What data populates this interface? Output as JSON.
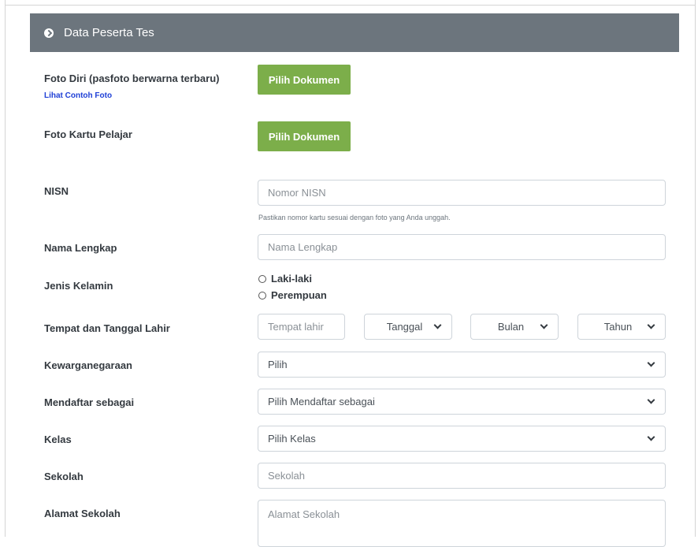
{
  "panel": {
    "title": "Data Peserta Tes",
    "icon": "chevron-circle-right-icon"
  },
  "colors": {
    "header_bg": "#6c757d",
    "button_bg": "#7cae4a",
    "link": "#1e3fd6"
  },
  "foto_diri": {
    "label": "Foto Diri (pasfoto berwarna terbaru)",
    "link": "Lihat Contoh Foto",
    "button": "Pilih Dokumen"
  },
  "foto_kartu": {
    "label": "Foto Kartu Pelajar",
    "button": "Pilih Dokumen"
  },
  "nisn": {
    "label": "NISN",
    "value": "",
    "placeholder": "Nomor NISN",
    "help": "Pastikan nomor kartu sesuai dengan foto yang Anda unggah."
  },
  "nama": {
    "label": "Nama Lengkap",
    "value": "",
    "placeholder": "Nama Lengkap"
  },
  "jenis_kelamin": {
    "label": "Jenis Kelamin",
    "options": [
      "Laki-laki",
      "Perempuan"
    ],
    "selected": null
  },
  "ttl": {
    "label": "Tempat dan Tanggal Lahir",
    "tempat_placeholder": "Tempat lahir",
    "tanggal": "Tanggal",
    "bulan": "Bulan",
    "tahun": "Tahun"
  },
  "kewarganegaraan": {
    "label": "Kewarganegaraan",
    "selected": "Pilih"
  },
  "mendaftar": {
    "label": "Mendaftar sebagai",
    "selected": "Pilih Mendaftar sebagai"
  },
  "kelas": {
    "label": "Kelas",
    "selected": "Pilih Kelas"
  },
  "sekolah": {
    "label": "Sekolah",
    "value": "",
    "placeholder": "Sekolah"
  },
  "alamat": {
    "label": "Alamat Sekolah",
    "value": "",
    "placeholder": "Alamat Sekolah"
  }
}
